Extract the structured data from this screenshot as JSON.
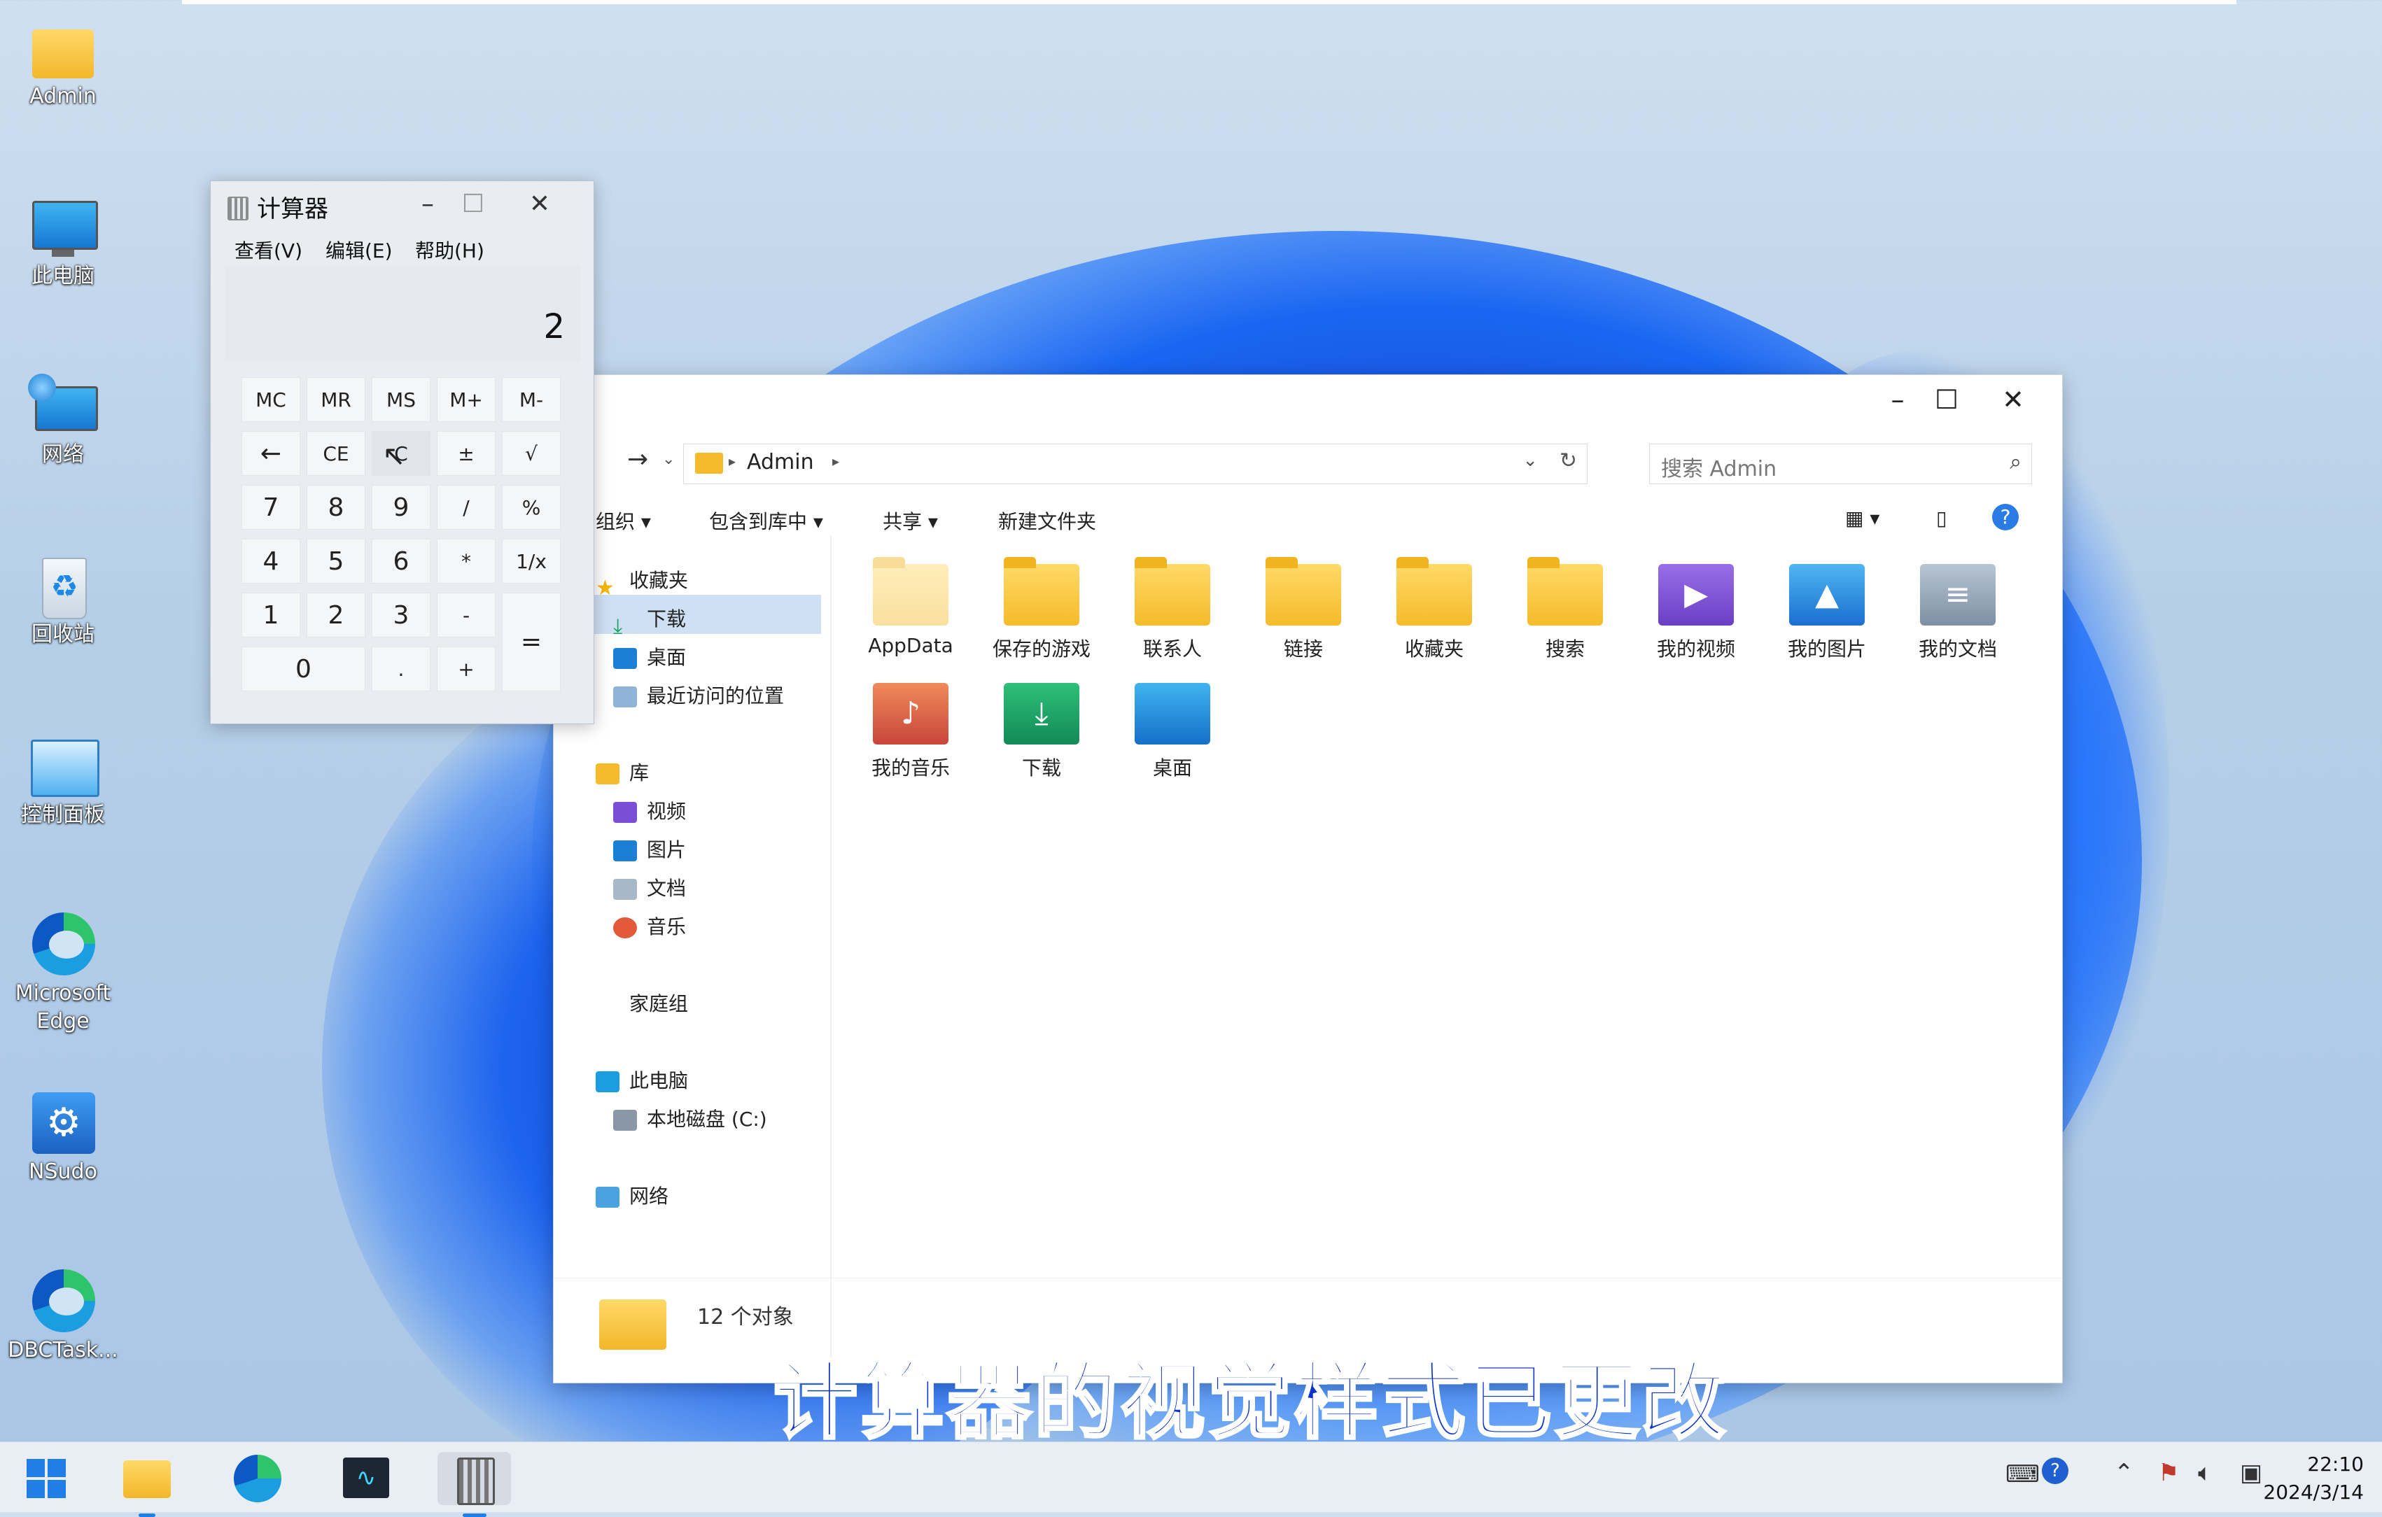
{
  "desktop": {
    "icons": [
      {
        "label": "Admin"
      },
      {
        "label": "此电脑"
      },
      {
        "label": "网络"
      },
      {
        "label": "回收站"
      },
      {
        "label": "控制面板"
      },
      {
        "label": "Microsoft Edge"
      },
      {
        "label": "NSudo"
      },
      {
        "label": "DBCTask..."
      }
    ]
  },
  "calculator": {
    "title": "计算器",
    "menu": [
      "查看(V)",
      "编辑(E)",
      "帮助(H)"
    ],
    "display": "2",
    "buttons": {
      "mc": "MC",
      "mr": "MR",
      "ms": "MS",
      "mplus": "M+",
      "mminus": "M-",
      "back": "←",
      "ce": "CE",
      "c": "C",
      "plusminus": "±",
      "sqrt": "√",
      "n7": "7",
      "n8": "8",
      "n9": "9",
      "div": "/",
      "pct": "%",
      "n4": "4",
      "n5": "5",
      "n6": "6",
      "mul": "*",
      "recip": "1/x",
      "n1": "1",
      "n2": "2",
      "n3": "3",
      "sub": "-",
      "eq": "=",
      "n0": "0",
      "dot": ".",
      "add": "+"
    }
  },
  "explorer": {
    "breadcrumb": "Admin",
    "search_placeholder": "搜索 Admin",
    "toolbar": {
      "organize": "组织",
      "include": "包含到库中",
      "share": "共享",
      "new_folder": "新建文件夹"
    },
    "nav": {
      "favorites": "收藏夹",
      "downloads": "下载",
      "desktop": "桌面",
      "recent": "最近访问的位置",
      "libraries": "库",
      "videos": "视频",
      "pictures": "图片",
      "docs": "文档",
      "music": "音乐",
      "homegroup": "家庭组",
      "this_pc": "此电脑",
      "local_disk": "本地磁盘 (C:)",
      "network": "网络"
    },
    "files": [
      {
        "name": "AppData",
        "icon": "folder-faded"
      },
      {
        "name": "保存的游戏",
        "icon": "folder"
      },
      {
        "name": "联系人",
        "icon": "folder"
      },
      {
        "name": "链接",
        "icon": "folder"
      },
      {
        "name": "收藏夹",
        "icon": "folder"
      },
      {
        "name": "搜索",
        "icon": "folder"
      },
      {
        "name": "我的视频",
        "icon": "video-folder"
      },
      {
        "name": "我的图片",
        "icon": "pictures-folder"
      },
      {
        "name": "我的文档",
        "icon": "documents-folder"
      },
      {
        "name": "我的音乐",
        "icon": "music-folder"
      },
      {
        "name": "下载",
        "icon": "downloads-folder"
      },
      {
        "name": "桌面",
        "icon": "desktop-folder"
      }
    ],
    "status": "12 个对象"
  },
  "subtitle": "计算器的视觉样式已更改",
  "taskbar": {
    "time": "22:10",
    "date": "2024/3/14"
  },
  "colors": {
    "accent": "#1a66f2",
    "subtitle": "#0c33c8",
    "folder": "#f5bb2a"
  }
}
